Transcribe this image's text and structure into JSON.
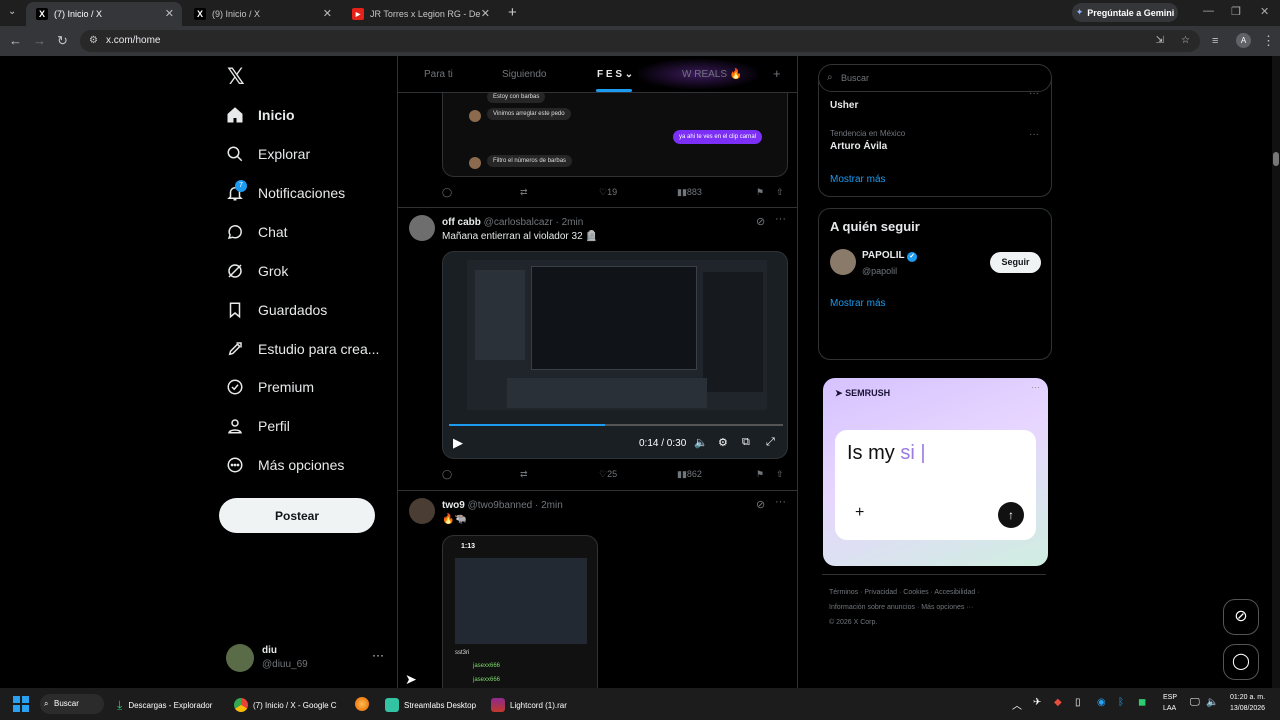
{
  "browser": {
    "tabs": [
      {
        "title": "(7) Inicio / X",
        "active": true
      },
      {
        "title": "(9) Inicio / X",
        "active": false
      },
      {
        "title": "JR Torres x Legion RG - De Hech",
        "active": false
      }
    ],
    "gemini_label": "Pregúntale a Gemini",
    "url": "x.com/home",
    "profile_initial": "A"
  },
  "sidebar": {
    "items": [
      {
        "label": "Inicio",
        "icon": "home-icon"
      },
      {
        "label": "Explorar",
        "icon": "search-icon"
      },
      {
        "label": "Notificaciones",
        "icon": "bell-icon",
        "badge": "7"
      },
      {
        "label": "Chat",
        "icon": "chat-icon"
      },
      {
        "label": "Grok",
        "icon": "grok-icon"
      },
      {
        "label": "Guardados",
        "icon": "bookmark-icon"
      },
      {
        "label": "Estudio para crea...",
        "icon": "rocket-icon"
      },
      {
        "label": "Premium",
        "icon": "premium-icon"
      },
      {
        "label": "Perfil",
        "icon": "user-icon"
      },
      {
        "label": "Más opciones",
        "icon": "more-icon"
      }
    ],
    "post_button": "Postear",
    "account": {
      "name": "diu",
      "handle": "@diuu_69"
    }
  },
  "feed_tabs": [
    "Para ti",
    "Siguiendo",
    "F E S",
    "W REALS 🔥"
  ],
  "tweet1": {
    "chat_lines": [
      "Estoy con barbas",
      "Vinimos arreglar este pedo",
      "ya ahi te ves en el clip carnal",
      "Filtro el números de barbas"
    ],
    "likes": "19",
    "views": "883"
  },
  "tweet2": {
    "name": "off cabb",
    "handle": "@carlosbalcazr",
    "time": "· 2min",
    "text": "Mañana entierran al violador 32 🪦",
    "video_time": "0:14 / 0:30",
    "likes": "25",
    "views": "862"
  },
  "tweet3": {
    "name": "two9",
    "handle": "@two9banned",
    "time": "· 2min",
    "text": "🔥🐃",
    "phone_time": "1:13",
    "phone_user": "sst3ri",
    "phone_rows": [
      "jasexx666",
      "jasexx666"
    ]
  },
  "right": {
    "search_placeholder": "Buscar",
    "trend_top": "Usher",
    "trend_label": "Tendencia en México",
    "trend_name": "Arturo Ávila",
    "show_more": "Mostrar más",
    "follow_title": "A quién seguir",
    "follow_name": "PAPOLIL",
    "follow_handle": "@papolil",
    "follow_button": "Seguir",
    "ad_brand": "SEMRUSH",
    "ad_text_dark": "Is my",
    "ad_text_light": "si",
    "footer_line1": "Términos · Privacidad · Cookies · Accesibilidad ·",
    "footer_line2": "Información sobre anuncios · Más opciones ···",
    "footer_line3": "© 2026 X Corp."
  },
  "taskbar": {
    "search": "Buscar",
    "apps": [
      "Descargas - Explorador",
      "(7) Inicio / X - Google C",
      "Streamlabs Desktop",
      "Lightcord (1).rar"
    ],
    "lang": "ESP",
    "lang2": "LAA",
    "time": "01:20 a. m.",
    "date": "13/08/2026"
  }
}
